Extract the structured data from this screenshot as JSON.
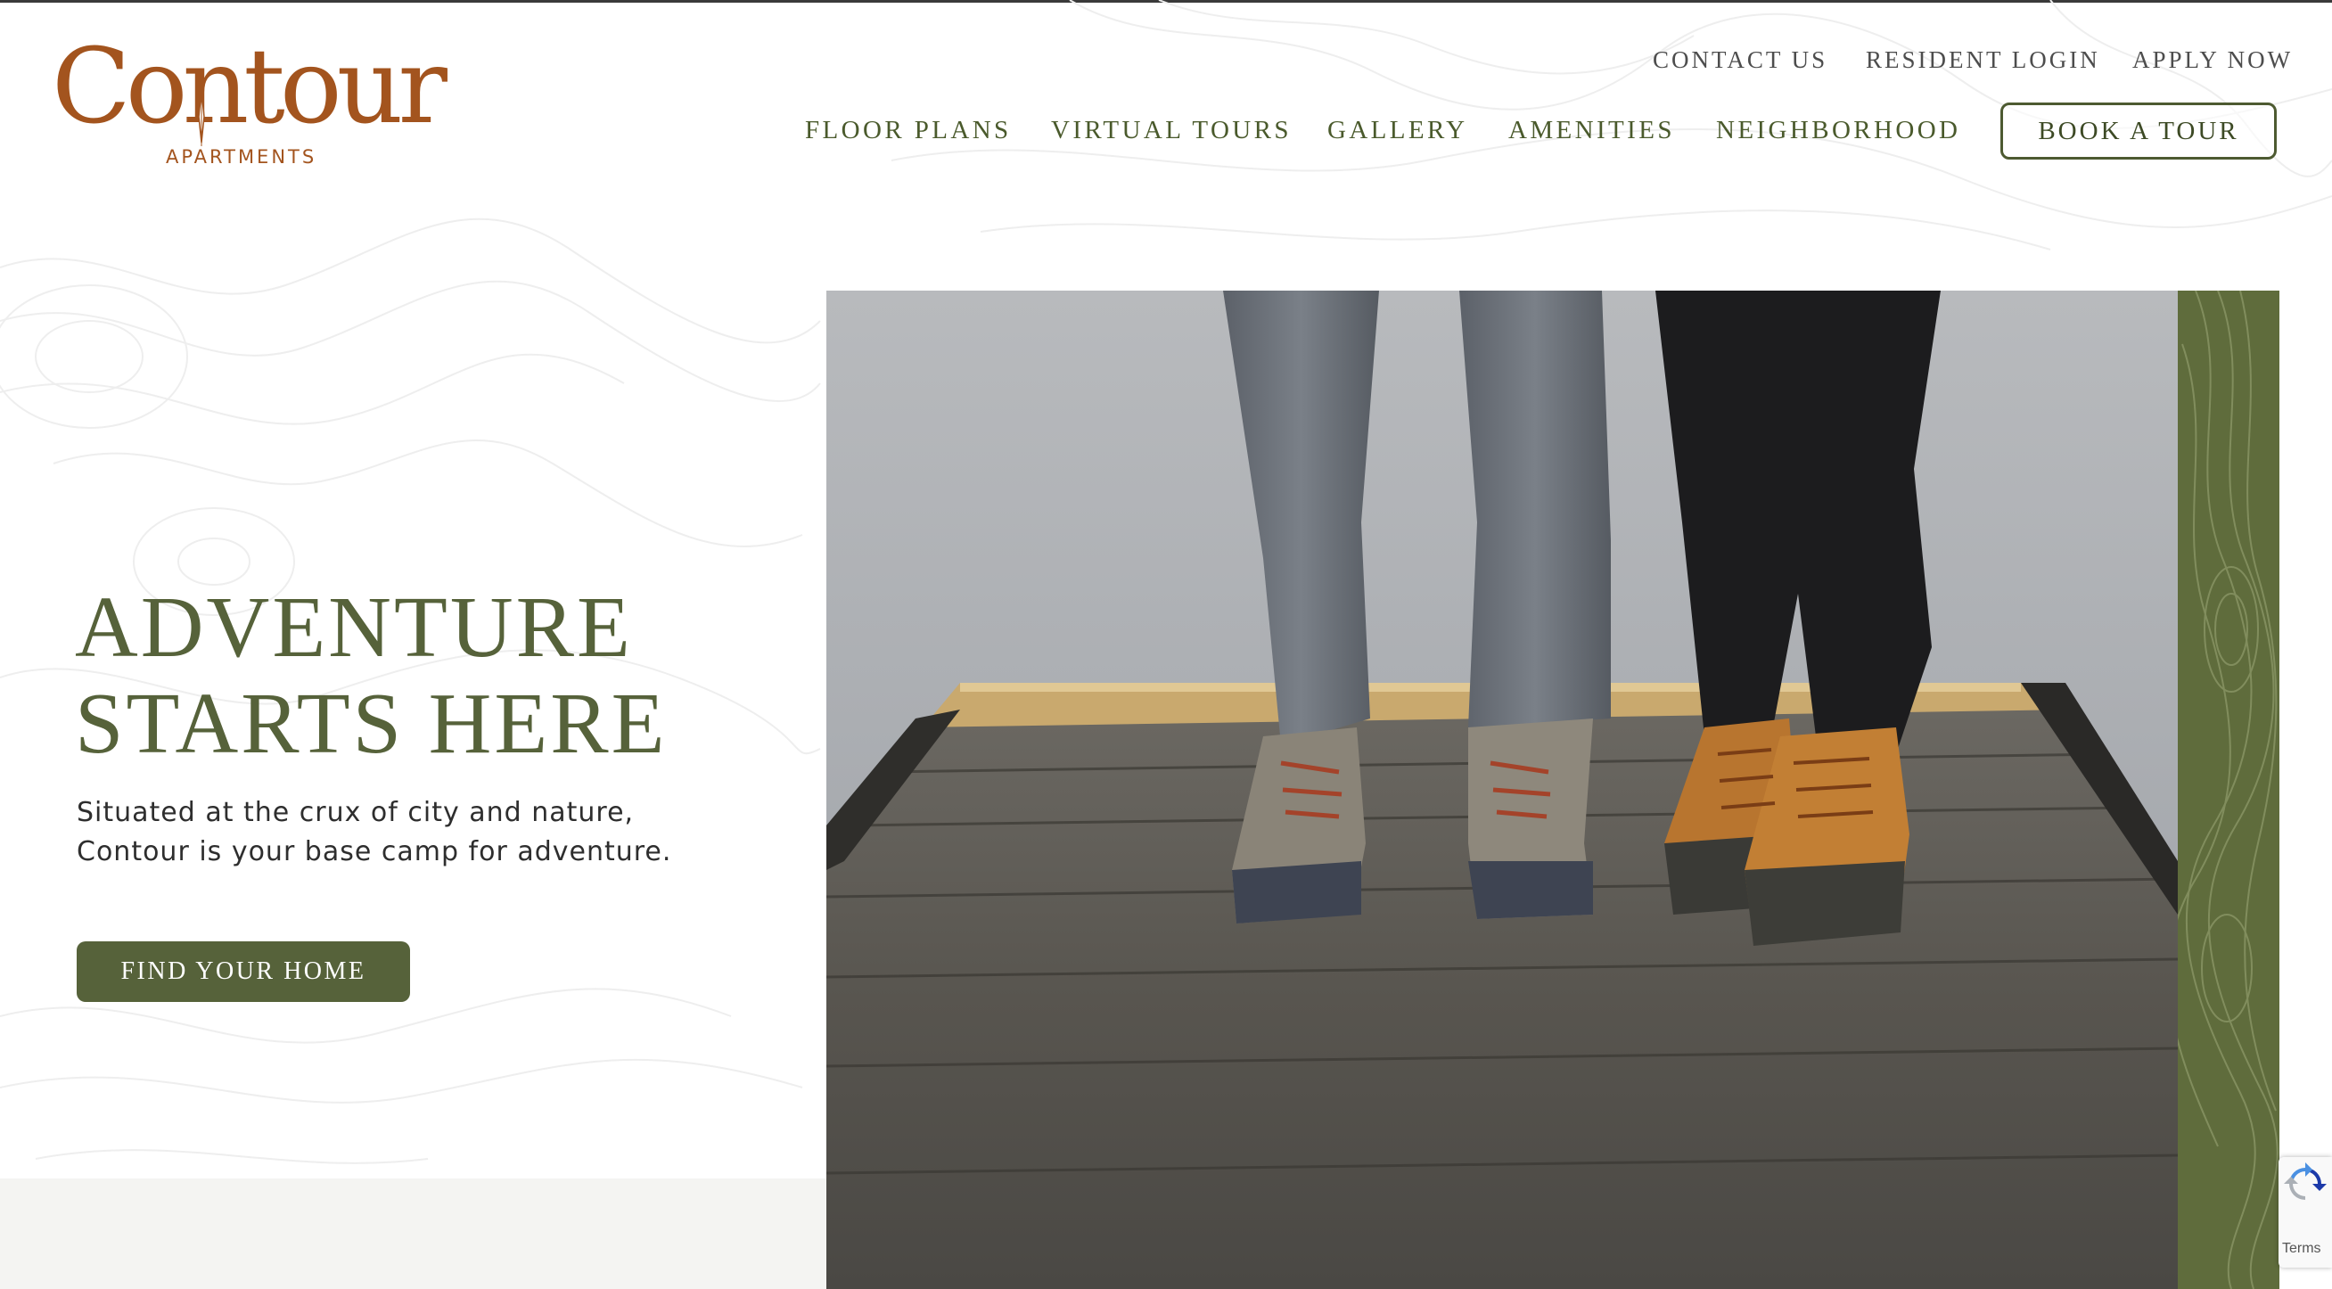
{
  "brand": {
    "name": "Contour",
    "subtitle": "APARTMENTS",
    "color": "#a3541e"
  },
  "utility_nav": {
    "contact": "CONTACT US",
    "resident_login": "RESIDENT LOGIN",
    "apply": "APPLY NOW"
  },
  "main_nav": {
    "items": [
      "FLOOR PLANS",
      "VIRTUAL TOURS",
      "GALLERY",
      "AMENITIES",
      "NEIGHBORHOOD"
    ],
    "cta": "BOOK A TOUR"
  },
  "hero": {
    "headline_line1": "ADVENTURE",
    "headline_line2": "STARTS HERE",
    "subtext_line1": "Situated at the crux of city and nature,",
    "subtext_line2": "Contour is your base camp for adventure.",
    "cta": "FIND YOUR HOME",
    "image_alt": "Two people in duck boots standing on a weathered wooden dock"
  },
  "recaptcha": {
    "terms": "Terms"
  },
  "colors": {
    "accent_green": "#56623a",
    "band_green": "#5f6c3c",
    "text_dark": "#2e2e2e"
  }
}
